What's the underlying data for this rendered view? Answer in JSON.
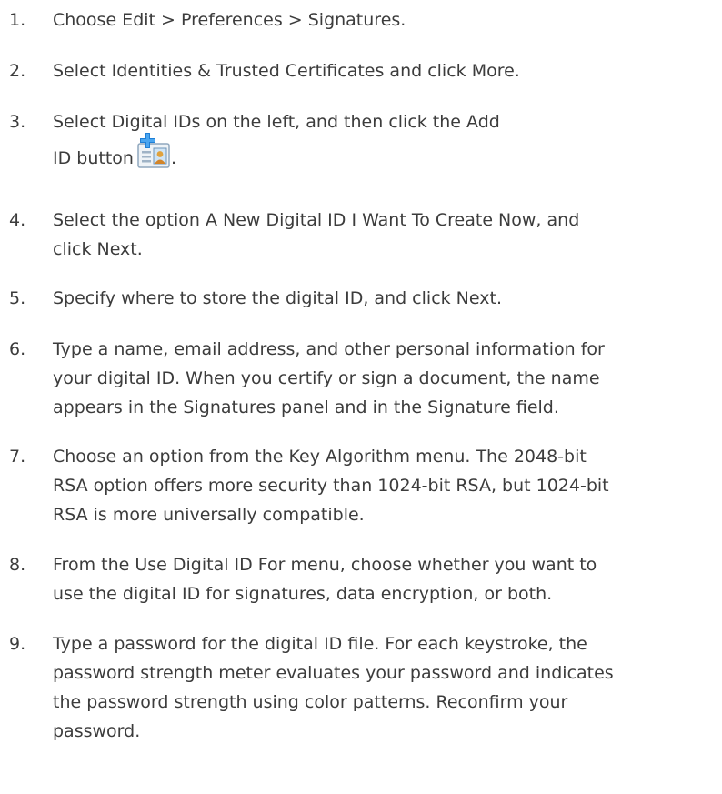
{
  "steps": [
    {
      "num": "1.",
      "lines": [
        "Choose Edit > Preferences > Signatures."
      ]
    },
    {
      "num": "2.",
      "lines": [
        "Select Identities & Trusted Certificates and click More."
      ]
    },
    {
      "num": "3.",
      "lines": [
        "Select Digital IDs on the left, and then click the Add",
        "ID button"
      ],
      "trailing": ".",
      "icon": "add-id-icon"
    },
    {
      "num": "4.",
      "lines": [
        "Select the option A New Digital ID I Want To Create Now, and",
        "click Next."
      ]
    },
    {
      "num": "5.",
      "lines": [
        "Specify where to store the digital ID, and click Next."
      ]
    },
    {
      "num": "6.",
      "lines": [
        "Type a name, email address, and other personal information for",
        "your digital ID. When you certify or sign a document, the name",
        "appears in the Signatures panel and in the Signature field."
      ]
    },
    {
      "num": "7.",
      "lines": [
        "Choose an option from the Key Algorithm menu. The 2048-bit",
        "RSA option offers more security than 1024-bit RSA, but 1024-bit",
        "RSA is more universally compatible."
      ]
    },
    {
      "num": "8.",
      "lines": [
        "From the Use Digital ID For menu, choose whether you want to",
        "use the digital ID for signatures, data encryption, or both."
      ]
    },
    {
      "num": "9.",
      "lines": [
        "Type a password for the digital ID file. For each keystroke, the",
        "password strength meter evaluates your password and indicates",
        "the password strength using color patterns. Reconfirm your",
        "password."
      ]
    }
  ]
}
